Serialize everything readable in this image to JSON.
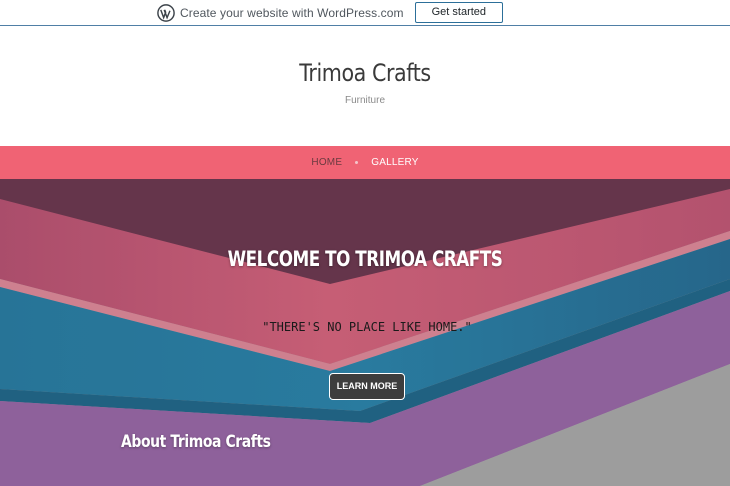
{
  "promo_bar": {
    "logo_icon": "wordpress-icon",
    "text": "Create your website with WordPress.com",
    "button_label": "Get started"
  },
  "site": {
    "title": "Trimoa Crafts",
    "tagline": "Furniture"
  },
  "nav": {
    "items": [
      {
        "label": "HOME",
        "active": false
      },
      {
        "label": "GALLERY",
        "active": true
      }
    ]
  },
  "hero": {
    "title": "WELCOME TO TRIMOA CRAFTS",
    "quote": "\"THERE'S NO PLACE LIKE HOME.\"",
    "button_label": "LEARN MORE",
    "colors": {
      "pink": "#d0607a",
      "blue": "#2a7fa5",
      "purple": "#9a6aa8",
      "gray": "#a8a8a8"
    }
  },
  "about": {
    "title": "About Trimoa Crafts"
  },
  "colors": {
    "nav_background": "#f06374",
    "promo_border": "#4f7fa6"
  }
}
